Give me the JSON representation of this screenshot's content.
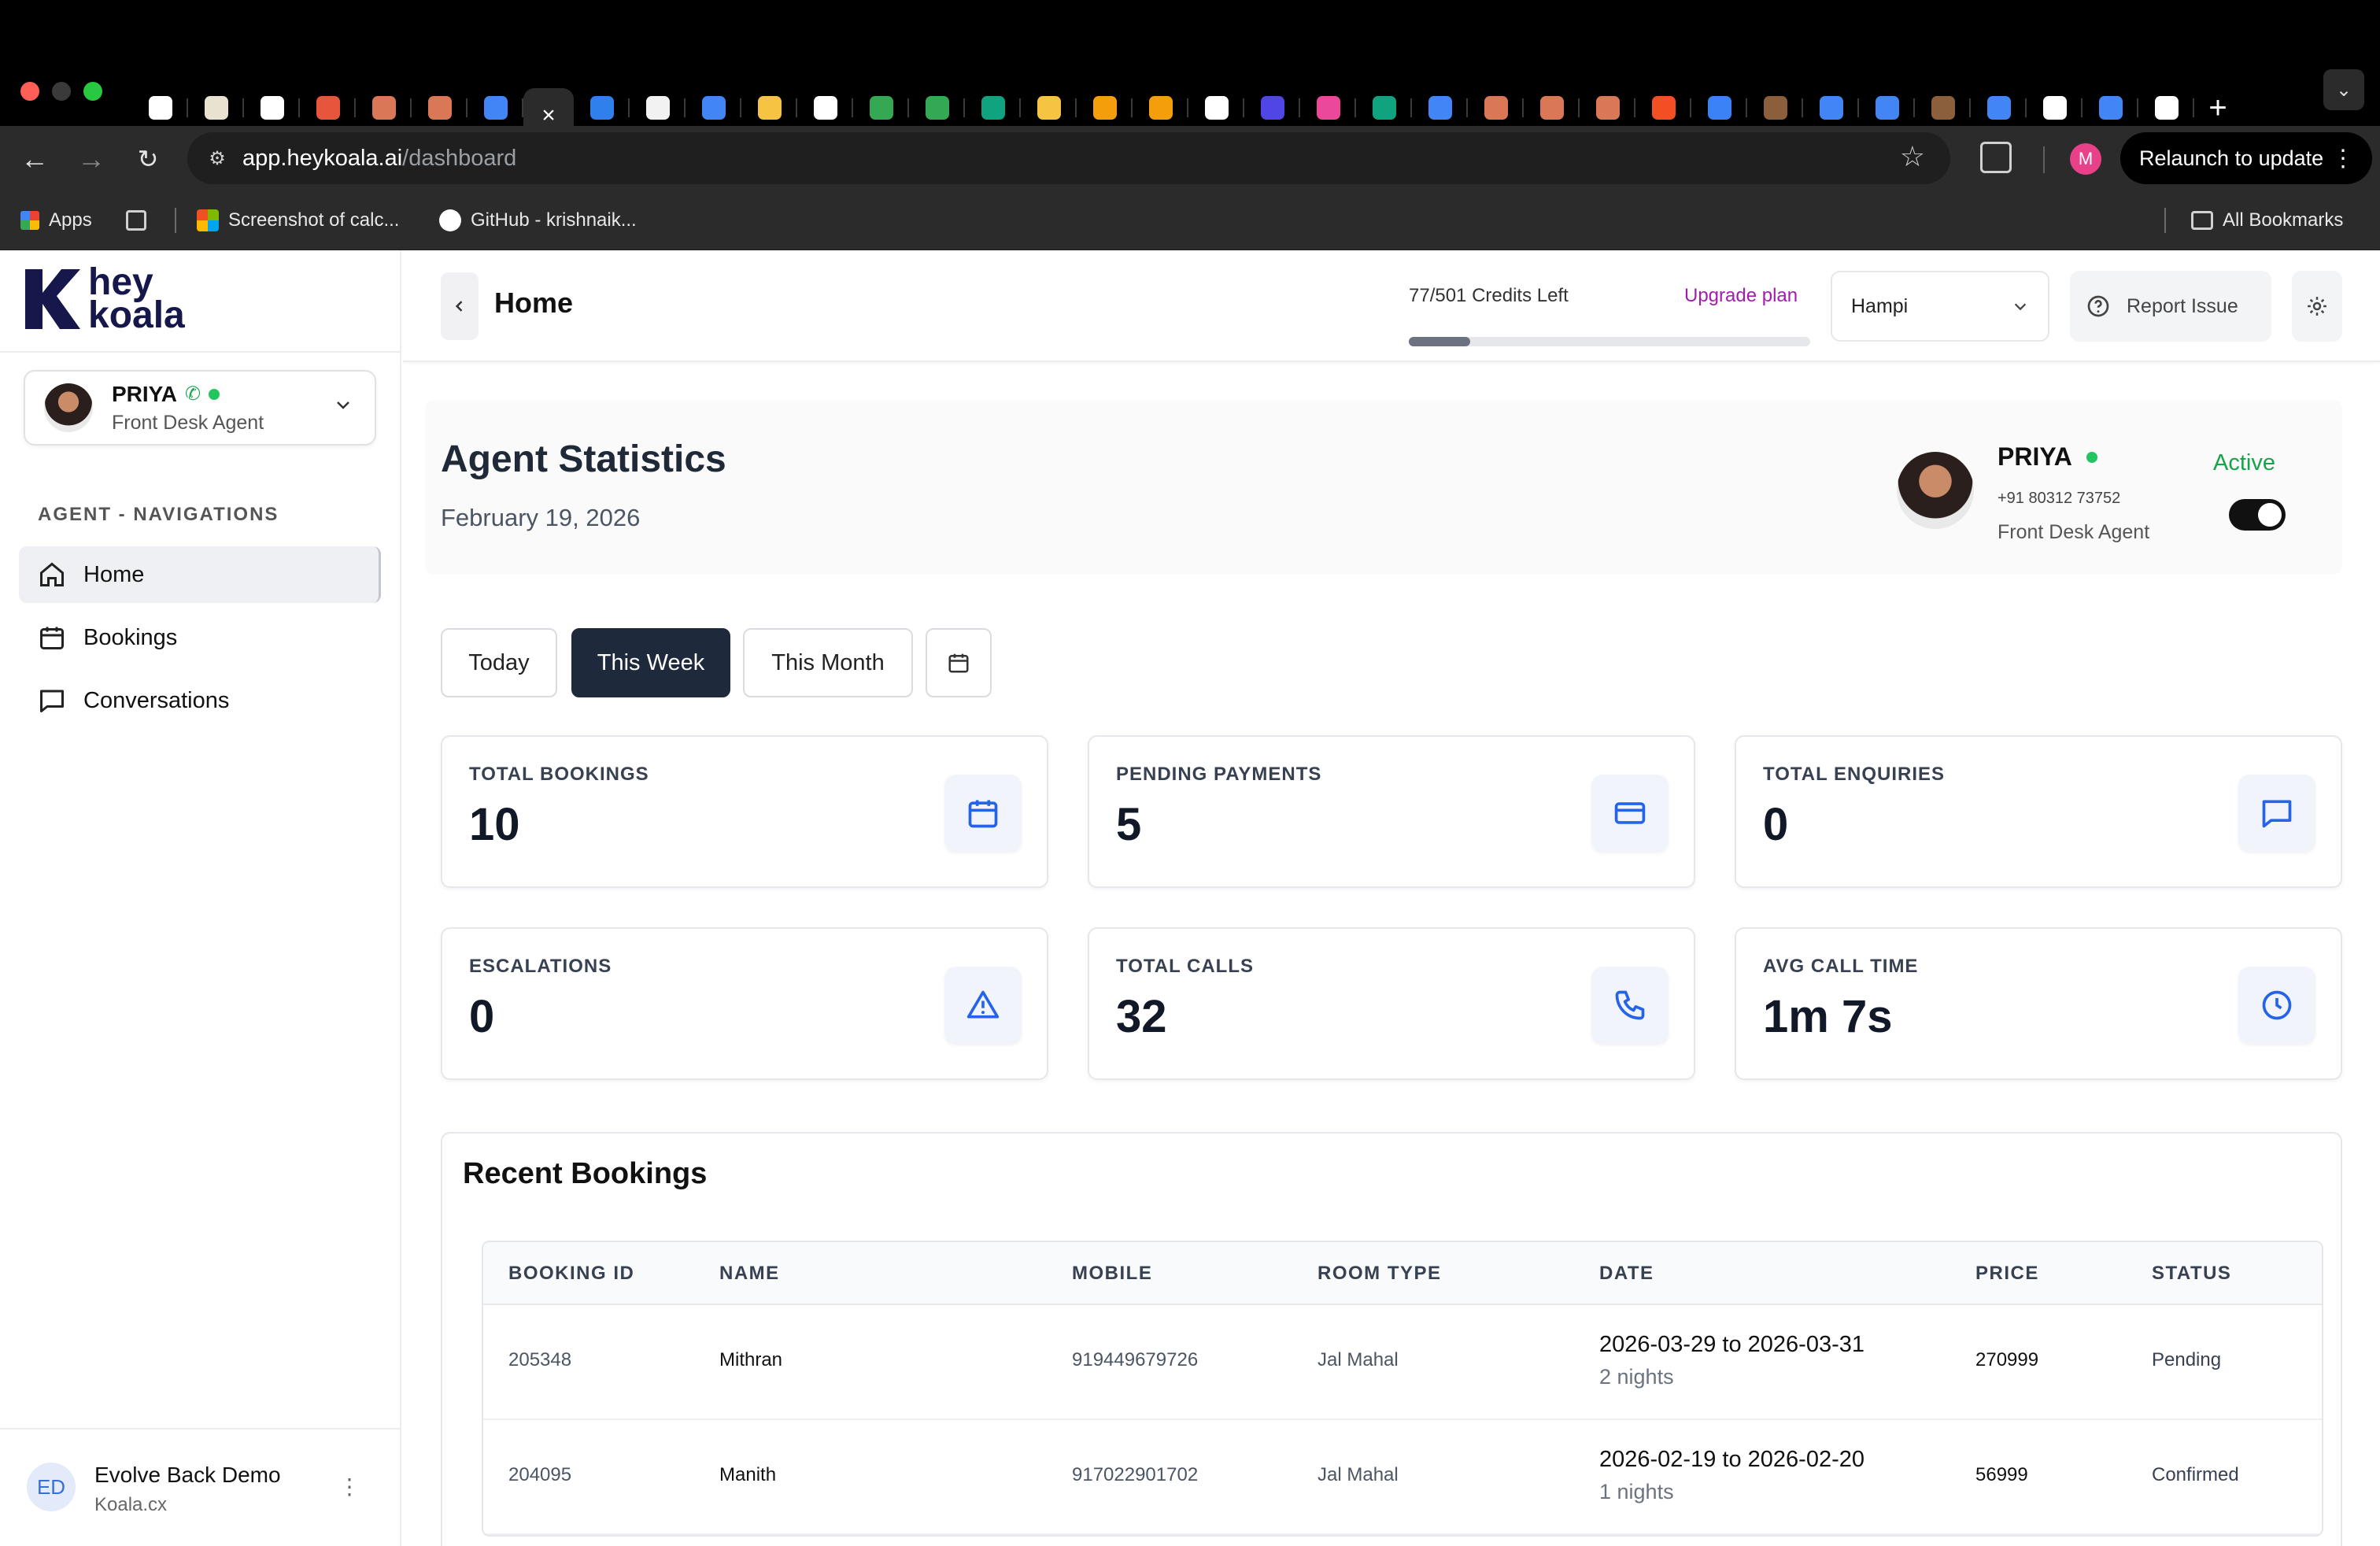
{
  "browser": {
    "url_host": "app.heykoala.ai",
    "url_path": "/dashboard",
    "active_tab_close": "×",
    "new_tab": "+",
    "relaunch_label": "Relaunch to update",
    "profile_initial": "M",
    "bookmarks": {
      "apps": "Apps",
      "item1": "Screenshot of calc...",
      "item2": "GitHub - krishnaik...",
      "all": "All Bookmarks"
    },
    "tab_icon_colors": [
      "#ffffff",
      "#e9e2d0",
      "#ffffff",
      "#e8553d",
      "#d97757",
      "#d97757",
      "#4285f4",
      "ACTIVE",
      "#2f80ed",
      "#f2f2f2",
      "#4285f4",
      "#f6c343",
      "#ffffff",
      "#34a853",
      "#34a853",
      "#10a37f",
      "#f6c343",
      "#f59e0b",
      "#f59e0b",
      "#ffffff",
      "#4f46e5",
      "#ec4899",
      "#10a37f",
      "#4285f4",
      "#d97757",
      "#d97757",
      "#d97757",
      "#f25022",
      "#3b82f6",
      "#8b5e3c",
      "#4285f4",
      "#4285f4",
      "#8b5e3c",
      "#4285f4",
      "#ffffff",
      "#4285f4",
      "#ffffff"
    ]
  },
  "sidebar": {
    "logo_line1": "hey",
    "logo_line2": "koala",
    "agent": {
      "name": "PRIYA",
      "role": "Front Desk Agent"
    },
    "nav_title": "AGENT - NAVIGATIONS",
    "items": [
      {
        "label": "Home",
        "icon": "home-icon"
      },
      {
        "label": "Bookings",
        "icon": "calendar-icon"
      },
      {
        "label": "Conversations",
        "icon": "chat-icon"
      }
    ],
    "org": {
      "initials": "ED",
      "name": "Evolve Back Demo",
      "sub": "Koala.cx"
    }
  },
  "topbar": {
    "title": "Home",
    "credits": "77/501 Credits Left",
    "credits_used": 77,
    "credits_total": 501,
    "upgrade": "Upgrade plan",
    "property": "Hampi",
    "report": "Report Issue"
  },
  "stats": {
    "title": "Agent Statistics",
    "date": "February 19, 2026",
    "agent_name": "PRIYA",
    "agent_phone": "+91 80312 73752",
    "agent_role": "Front Desk Agent",
    "status": "Active",
    "ranges": [
      "Today",
      "This Week",
      "This Month"
    ],
    "selected_range": "This Week",
    "cards": [
      {
        "label": "TOTAL BOOKINGS",
        "value": "10",
        "icon": "calendar-icon"
      },
      {
        "label": "PENDING PAYMENTS",
        "value": "5",
        "icon": "credit-card-icon"
      },
      {
        "label": "TOTAL ENQUIRIES",
        "value": "0",
        "icon": "chat-icon"
      },
      {
        "label": "ESCALATIONS",
        "value": "0",
        "icon": "warning-icon"
      },
      {
        "label": "TOTAL CALLS",
        "value": "32",
        "icon": "phone-icon"
      },
      {
        "label": "AVG CALL TIME",
        "value": "1m 7s",
        "icon": "clock-icon"
      }
    ]
  },
  "bookings": {
    "title": "Recent Bookings",
    "columns": [
      "BOOKING ID",
      "NAME",
      "MOBILE",
      "ROOM TYPE",
      "DATE",
      "PRICE",
      "STATUS"
    ],
    "rows": [
      {
        "id": "205348",
        "name": "Mithran",
        "mobile": "919449679726",
        "room": "Jal Mahal",
        "date": "2026-03-29 to 2026-03-31",
        "nights": "2 nights",
        "price": "270999",
        "status": "Pending"
      },
      {
        "id": "204095",
        "name": "Manith",
        "mobile": "917022901702",
        "room": "Jal Mahal",
        "date": "2026-02-19 to 2026-02-20",
        "nights": "1 nights",
        "price": "56999",
        "status": "Confirmed"
      }
    ]
  },
  "colors": {
    "accent_dark": "#1e293b",
    "status_green": "#22c55e",
    "icon_blue": "#2563eb",
    "upgrade_purple": "#a21caf"
  }
}
